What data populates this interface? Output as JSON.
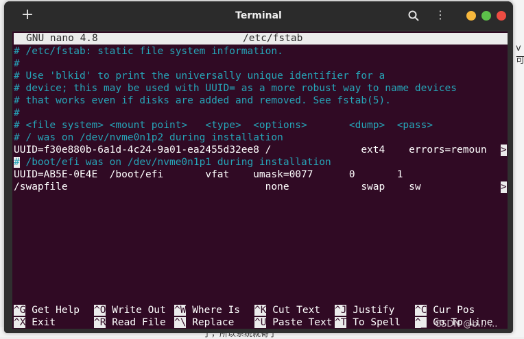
{
  "window": {
    "title": "Terminal",
    "new_tab_glyph": "+",
    "menu_glyph": "⋮"
  },
  "nano": {
    "version": "GNU nano 4.8",
    "filename": "/etc/fstab"
  },
  "lines": [
    "# /etc/fstab: static file system information.",
    "#",
    "# Use 'blkid' to print the universally unique identifier for a",
    "# device; this may be used with UUID= as a more robust way to name devices",
    "# that works even if disks are added and removed. See fstab(5).",
    "#",
    "# <file system> <mount point>   <type>  <options>       <dump>  <pass>",
    "# / was on /dev/nvme0n1p2 during installation",
    "UUID=f30e880b-6a1d-4c24-9a01-ea2455d32ee8 /               ext4    errors=remoun",
    " /boot/efi was on /dev/nvme0n1p1 during installation",
    "UUID=AB5E-0E4E  /boot/efi       vfat    umask=0077      0       1",
    "/swapfile                                 none            swap    sw"
  ],
  "cursor_char": "#",
  "overflow_marker": ">",
  "shortcuts": [
    {
      "key": "^G",
      "label": "Get Help"
    },
    {
      "key": "^O",
      "label": "Write Out"
    },
    {
      "key": "^W",
      "label": "Where Is"
    },
    {
      "key": "^K",
      "label": "Cut Text"
    },
    {
      "key": "^J",
      "label": "Justify"
    },
    {
      "key": "^C",
      "label": "Cur Pos"
    },
    {
      "key": "^X",
      "label": "Exit"
    },
    {
      "key": "^R",
      "label": "Read File"
    },
    {
      "key": "^\\",
      "label": "Replace"
    },
    {
      "key": "^U",
      "label": "Paste Text"
    },
    {
      "key": "^T",
      "label": "To Spell"
    },
    {
      "key": "^_",
      "label": "Go To Line"
    }
  ],
  "background": {
    "bottom_text": "了，所以系统就寄了",
    "right_text": "v\n可",
    "watermark": "CSDN @b... ..."
  },
  "colors": {
    "terminal_bg": "#300a24",
    "comment": "#26a5b8",
    "titlebar": "#2b2b2b"
  }
}
